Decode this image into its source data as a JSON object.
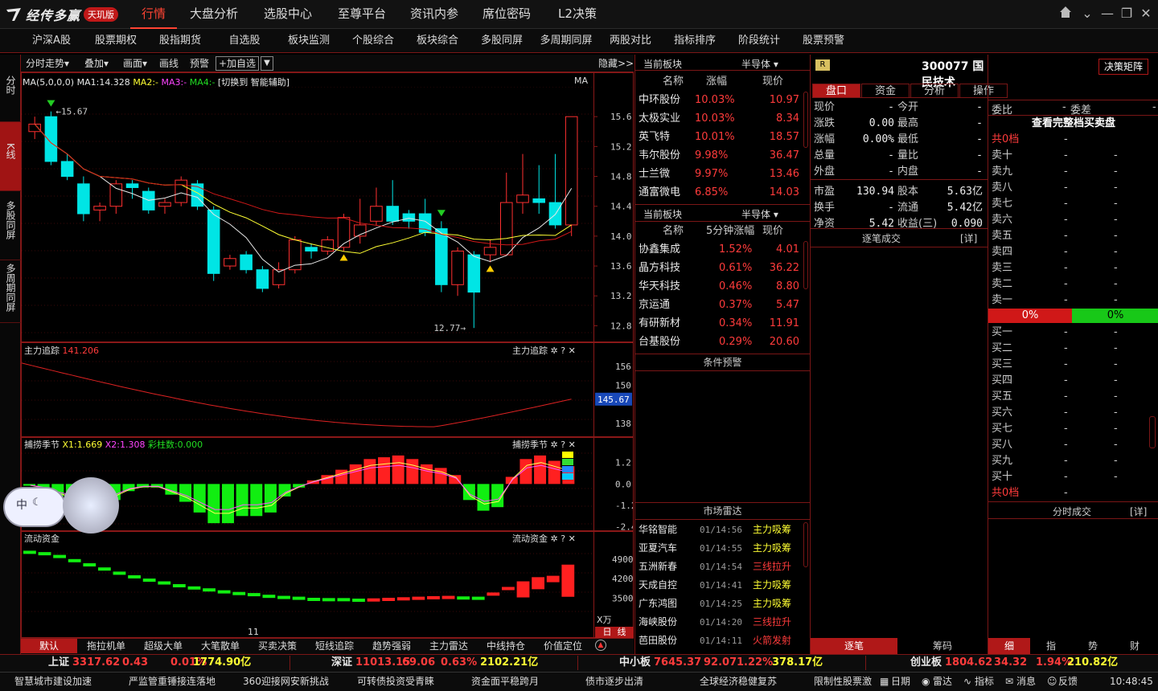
{
  "app": {
    "name": "经传多赢",
    "edition": "天玑版"
  },
  "top_nav": [
    "行情",
    "大盘分析",
    "选股中心",
    "至尊平台",
    "资讯内参",
    "席位密码",
    "L2决策"
  ],
  "sub_nav": [
    "沪深A股",
    "股票期权",
    "股指期货",
    "自选股",
    "板块监测",
    "个股综合",
    "板块综合",
    "多股同屏",
    "多周期同屏",
    "两股对比",
    "指标排序",
    "阶段统计",
    "股票预警"
  ],
  "left_tabs": [
    "分时",
    "K线",
    "多股同屏",
    "多周期同屏"
  ],
  "chart_toolbar": {
    "items": [
      "分时走势▾",
      "叠加▾",
      "画面▾",
      "画线",
      "预警"
    ],
    "add_fav": "+加自选",
    "hide": "隐藏>>"
  },
  "ma_line": {
    "ma": "MA(5,0,0,0)",
    "ma1": "MA1:14.328",
    "ma2": "MA2:-",
    "ma3": "MA3:-",
    "ma4": "MA4:-",
    "switch": "[切换到 智能辅助]",
    "right": "MA"
  },
  "price_high_label": "15.67",
  "price_low_label": "12.77",
  "x_label": "11",
  "indicators": {
    "zhuli": {
      "name": "主力追踪",
      "value": "141.206",
      "right": "主力追踪",
      "current": "145.67"
    },
    "buhuo": {
      "name": "捕捞季节",
      "x1": "X1:1.669",
      "x2": "X2:1.308",
      "bar": "彩柱数:0.000",
      "right": "捕捞季节"
    },
    "liudong": {
      "name": "流动资金",
      "right": "流动资金",
      "unit": "X万"
    }
  },
  "bottom_tabs": [
    "默认",
    "拖拉机单",
    "超级大单",
    "大笔散单",
    "买卖决策",
    "短线追踪",
    "趋势强弱",
    "主力雷达",
    "中线持仓",
    "价值定位"
  ],
  "bottom_right": {
    "day": "日",
    "line": "线"
  },
  "sector_list_1": {
    "title": "当前板块",
    "sector": "半导体 ▾",
    "headers": [
      "名称",
      "涨幅",
      "现价"
    ],
    "rows": [
      [
        "中环股份",
        "10.03%",
        "10.97"
      ],
      [
        "太极实业",
        "10.03%",
        "8.34"
      ],
      [
        "英飞特",
        "10.01%",
        "18.57"
      ],
      [
        "韦尔股份",
        "9.98%",
        "36.47"
      ],
      [
        "士兰微",
        "9.97%",
        "13.46"
      ],
      [
        "通富微电",
        "6.85%",
        "14.03"
      ]
    ]
  },
  "sector_list_2": {
    "title": "当前板块",
    "sector": "半导体 ▾",
    "headers": [
      "名称",
      "5分钟涨幅",
      "现价"
    ],
    "rows": [
      [
        "协鑫集成",
        "1.52%",
        "4.01"
      ],
      [
        "晶方科技",
        "0.61%",
        "36.22"
      ],
      [
        "华天科技",
        "0.46%",
        "8.80"
      ],
      [
        "京运通",
        "0.37%",
        "5.47"
      ],
      [
        "有研新材",
        "0.34%",
        "11.91"
      ],
      [
        "台基股份",
        "0.29%",
        "20.60"
      ]
    ]
  },
  "condition_alert": "条件预警",
  "market_radar": {
    "title": "市场雷达",
    "rows": [
      [
        "华铭智能",
        "01/14:56",
        "主力吸筹"
      ],
      [
        "亚夏汽车",
        "01/14:55",
        "主力吸筹"
      ],
      [
        "五洲新春",
        "01/14:54",
        "三线拉升"
      ],
      [
        "天成自控",
        "01/14:41",
        "主力吸筹"
      ],
      [
        "广东鸿图",
        "01/14:25",
        "主力吸筹"
      ],
      [
        "海峡股份",
        "01/14:20",
        "三线拉升"
      ],
      [
        "芭田股份",
        "01/14:11",
        "火箭发射"
      ]
    ]
  },
  "stock": {
    "badge": "R",
    "code": "300077",
    "name": "国民技术",
    "decision": "决策矩阵"
  },
  "stock_tabs": [
    "盘口",
    "资金",
    "分析",
    "操作"
  ],
  "quote": [
    [
      "现价",
      "-",
      "今开",
      "-"
    ],
    [
      "涨跌",
      "0.00",
      "最高",
      "-"
    ],
    [
      "涨幅",
      "0.00%",
      "最低",
      "-"
    ],
    [
      "总量",
      "-",
      "量比",
      "-"
    ],
    [
      "外盘",
      "-",
      "内盘",
      "-"
    ],
    [
      "市盈",
      "130.94",
      "股本",
      "5.63亿"
    ],
    [
      "换手",
      "-",
      "流通",
      "5.42亿"
    ],
    [
      "净资",
      "5.42",
      "收益(三)",
      "0.090"
    ]
  ],
  "tick_title": "逐笔成交",
  "tick_detail": "[详]",
  "order_book": {
    "weibi": "委比",
    "weicha": "委差",
    "dash": "-",
    "full": "查看完整档买卖盘",
    "sell_total": "共0档",
    "sells": [
      "卖十",
      "卖九",
      "卖八",
      "卖七",
      "卖六",
      "卖五",
      "卖四",
      "卖三",
      "卖二",
      "卖一"
    ],
    "pct_sell": "0%",
    "pct_buy": "0%",
    "buys": [
      "买一",
      "买二",
      "买三",
      "买四",
      "买五",
      "买六",
      "买七",
      "买八",
      "买九",
      "买十"
    ],
    "buy_total": "共0档"
  },
  "fenshi": {
    "title": "分时成交",
    "detail": "[详]"
  },
  "r1_bottom_tabs": [
    "逐笔",
    "筹码"
  ],
  "r2_bottom_tabs": [
    "细",
    "指",
    "势",
    "财"
  ],
  "indices": [
    {
      "name": "上证",
      "val": "3317.62",
      "chg": "0.43",
      "pct": "0.01%",
      "amt": "1774.90亿"
    },
    {
      "name": "深证",
      "val": "11013.15",
      "chg": "69.06",
      "pct": "0.63%",
      "amt": "2102.21亿"
    },
    {
      "name": "中小板",
      "val": "7645.37",
      "chg": "92.07",
      "pct": "1.22%",
      "amt": "378.17亿"
    },
    {
      "name": "创业板",
      "val": "1804.62",
      "chg": "34.32",
      "pct": "1.94%",
      "amt": "210.82亿"
    }
  ],
  "news": [
    "智慧城市建设加速",
    "严监管重锤接连落地",
    "360迎接网安新挑战",
    "可转债投资受青睐",
    "资金面平稳跨月",
    "债市逐步出清",
    "全球经济稳健复苏",
    "限制性股票激"
  ],
  "tray": [
    "日期",
    "雷达",
    "指标",
    "消息",
    "反馈"
  ],
  "clock": "10:48:45",
  "colors": {
    "up": "#ff3b3b",
    "down": "#22dd22",
    "accent": "#7a1616",
    "cyan": "#00e5e5"
  },
  "chart_data": [
    {
      "type": "candlestick",
      "title": "K线",
      "ylim": [
        12.6,
        16.0
      ],
      "yticks": [
        12.8,
        13.2,
        13.6,
        14.0,
        14.4,
        14.8,
        15.2,
        15.6
      ],
      "candles": [
        [
          15.4,
          15.5,
          15.3,
          15.6
        ],
        [
          15.6,
          15.0,
          14.95,
          15.67
        ],
        [
          15.0,
          14.8,
          14.75,
          15.1
        ],
        [
          14.7,
          14.3,
          14.2,
          14.8
        ],
        [
          14.35,
          14.4,
          14.2,
          14.45
        ],
        [
          14.4,
          14.7,
          14.3,
          14.75
        ],
        [
          14.7,
          14.65,
          14.5,
          14.75
        ],
        [
          14.6,
          14.35,
          14.3,
          14.65
        ],
        [
          14.4,
          14.45,
          14.3,
          14.5
        ],
        [
          14.45,
          14.75,
          14.4,
          14.8
        ],
        [
          14.7,
          14.4,
          14.35,
          14.75
        ],
        [
          14.35,
          13.5,
          13.4,
          14.4
        ],
        [
          13.6,
          13.7,
          13.55,
          13.75
        ],
        [
          13.75,
          13.55,
          13.5,
          13.8
        ],
        [
          13.55,
          13.3,
          13.25,
          13.6
        ],
        [
          13.35,
          13.55,
          13.3,
          13.65
        ],
        [
          13.55,
          13.95,
          13.5,
          14.0
        ],
        [
          13.85,
          13.8,
          13.7,
          13.9
        ],
        [
          13.8,
          13.95,
          13.75,
          14.0
        ],
        [
          13.85,
          14.25,
          13.8,
          14.3
        ],
        [
          14.0,
          14.15,
          13.9,
          14.5
        ],
        [
          14.2,
          14.4,
          14.15,
          14.65
        ],
        [
          14.4,
          14.2,
          14.15,
          14.75
        ],
        [
          14.3,
          14.2,
          14.1,
          14.35
        ],
        [
          14.3,
          14.05,
          14.0,
          14.5
        ],
        [
          14.1,
          13.35,
          13.25,
          14.2
        ],
        [
          13.35,
          13.8,
          13.2,
          13.85
        ],
        [
          13.75,
          13.25,
          12.77,
          13.8
        ],
        [
          13.75,
          13.85,
          13.65,
          13.95
        ],
        [
          13.75,
          14.45,
          13.75,
          14.85
        ],
        [
          14.45,
          14.55,
          14.3,
          15.1
        ],
        [
          14.5,
          14.45,
          14.3,
          14.95
        ],
        [
          14.45,
          14.15,
          14.1,
          15.1
        ],
        [
          14.15,
          15.6,
          14.0,
          15.6
        ]
      ]
    },
    {
      "type": "line",
      "title": "主力追踪",
      "ylim": [
        134,
        160
      ],
      "yticks": [
        138,
        145.67,
        150,
        156
      ]
    },
    {
      "type": "bar",
      "title": "捕捞季节",
      "ylim": [
        -2.6,
        2.0
      ],
      "yticks": [
        -2.4,
        -1.2,
        0.0,
        1.2
      ]
    },
    {
      "type": "bar",
      "title": "流动资金",
      "ylim": [
        2500,
        5500
      ],
      "yticks": [
        3500,
        4200,
        4900
      ]
    }
  ]
}
